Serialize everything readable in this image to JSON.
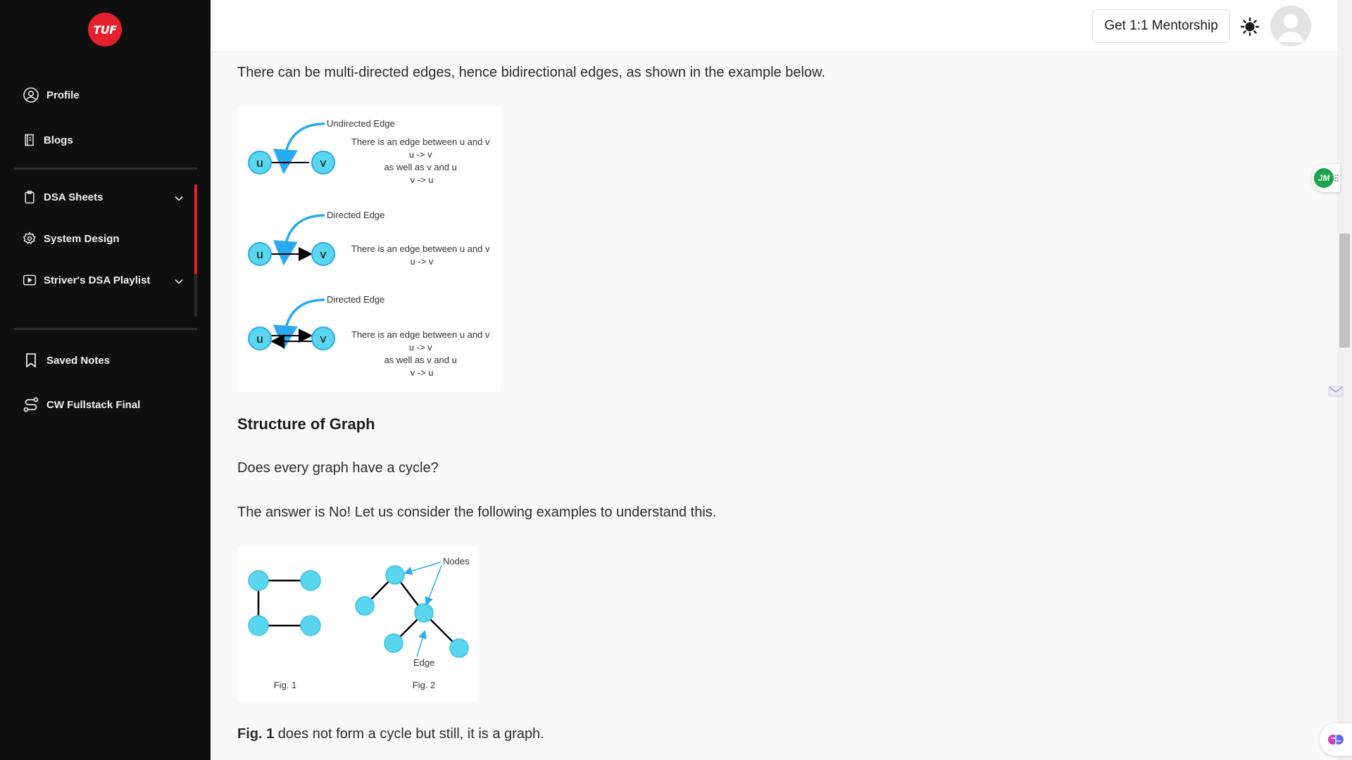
{
  "sidebar": {
    "logo_text": "TUF",
    "items": [
      {
        "label": "Profile",
        "icon": "user-circle-icon"
      },
      {
        "label": "Blogs",
        "icon": "book-icon"
      },
      {
        "label": "DSA Sheets",
        "icon": "clipboard-icon"
      },
      {
        "label": "System Design",
        "icon": "gear-icon"
      },
      {
        "label": "Striver's DSA Playlist",
        "icon": "play-icon"
      },
      {
        "label": "Saved Notes",
        "icon": "bookmark-icon"
      },
      {
        "label": "CW Fullstack Final",
        "icon": "route-icon"
      }
    ]
  },
  "header": {
    "mentorship_label": "Get 1:1 Mentorship"
  },
  "content": {
    "p1": "There can be multi-directed edges, hence bidirectional edges, as shown in the example below.",
    "heading": "Structure of Graph",
    "p2": "Does every graph have a cycle?",
    "p3": "The answer is No! Let us consider the following examples to understand this.",
    "p4_bold": "Fig. 1",
    "p4_rest": " does not form a cycle but still, it is a graph.",
    "figure1": {
      "undirected_title": "Undirected Edge",
      "undirected_desc": [
        "There is an edge between u and v",
        "u -> v",
        "as well as v and u",
        "v -> u"
      ],
      "directed_title": "Directed Edge",
      "directed_desc": [
        "There is an edge between u and v",
        "u -> v"
      ],
      "bidirected_title": "Directed Edge",
      "bidirected_desc": [
        "There is an edge between u and v",
        "u -> v",
        "as well as v and u",
        "v -> u"
      ],
      "node_u": "u",
      "node_v": "v"
    },
    "figure2": {
      "nodes_label": "Nodes",
      "edge_label": "Edge",
      "fig1_caption": "Fig. 1",
      "fig2_caption": "Fig. 2"
    }
  },
  "extensions": {
    "jm_badge": "JM"
  },
  "colors": {
    "sidebar_bg": "#0f0f0f",
    "brand_red": "#e5202e",
    "node_fill": "#5ad7ee",
    "arrow_blue": "#29a9f0"
  }
}
